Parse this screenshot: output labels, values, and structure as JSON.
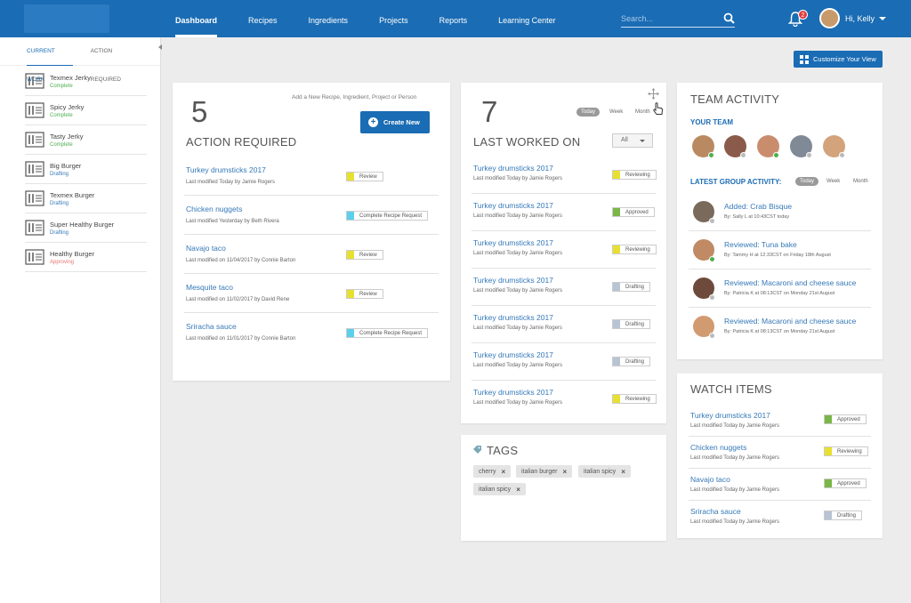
{
  "nav": {
    "items": [
      "Dashboard",
      "Recipes",
      "Ingredients",
      "Projects",
      "Reports",
      "Learning Center"
    ],
    "search_placeholder": "Search...",
    "notifications_count": "2",
    "user_greeting": "Hi, Kelly"
  },
  "sidebar": {
    "tabs": [
      "CURRENT WORK",
      "ACTION REQUIRED"
    ],
    "items": [
      {
        "name": "Texmex Jerky",
        "status": "Complete"
      },
      {
        "name": "Spicy Jerky",
        "status": "Complete"
      },
      {
        "name": "Tasty Jerky",
        "status": "Complete"
      },
      {
        "name": "Big Burger",
        "status": "Drafting"
      },
      {
        "name": "Texmex Burger",
        "status": "Drafting"
      },
      {
        "name": "Super Healthy Burger",
        "status": "Drafting"
      },
      {
        "name": "Healthy Burger",
        "status": "Approving"
      }
    ]
  },
  "customize_label": "Customize Your View",
  "action": {
    "count": "5",
    "title": "ACTION REQUIRED",
    "hint": "Add a New Recipe, Ingredient, Project or Person",
    "create_label": "Create New",
    "rows": [
      {
        "title": "Turkey drumsticks 2017",
        "sub": "Last modified Today by Jamie Rogers",
        "tag": "Review"
      },
      {
        "title": "Chicken nuggets",
        "sub": "Last modified Yesterday by Beth Rivera",
        "tag": "Complete Recipe Request"
      },
      {
        "title": "Navajo taco",
        "sub": "Last modified on 11/04/2017 by Connie Barton",
        "tag": "Review"
      },
      {
        "title": "Mesquite taco",
        "sub": "Last modified on 11/02/2017 by David Rene",
        "tag": "Review"
      },
      {
        "title": "Sriracha sauce",
        "sub": "Last modified on 11/01/2017 by Connie Barton",
        "tag": "Complete Recipe Request"
      }
    ]
  },
  "worked": {
    "count": "7",
    "title": "LAST WORKED ON",
    "periods": [
      "Today",
      "Week",
      "Month"
    ],
    "filter": "All",
    "rows": [
      {
        "title": "Turkey drumsticks 2017",
        "sub": "Last modified Today by Jamie Rogers",
        "tag": "Reviewing"
      },
      {
        "title": "Turkey drumsticks 2017",
        "sub": "Last modified Today by Jamie Rogers",
        "tag": "Approved"
      },
      {
        "title": "Turkey drumsticks 2017",
        "sub": "Last modified Today by Jamie Rogers",
        "tag": "Reviewing"
      },
      {
        "title": "Turkey drumsticks 2017",
        "sub": "Last modified Today by Jamie Rogers",
        "tag": "Drafting"
      },
      {
        "title": "Turkey drumsticks 2017",
        "sub": "Last modified Today by Jamie Rogers",
        "tag": "Drafting"
      },
      {
        "title": "Turkey drumsticks 2017",
        "sub": "Last modified Today by Jamie Rogers",
        "tag": "Drafting"
      },
      {
        "title": "Turkey drumsticks 2017",
        "sub": "Last modified Today by Jamie Rogers",
        "tag": "Reviewing"
      }
    ]
  },
  "tags": {
    "title": "TAGS",
    "items": [
      "cherry",
      "italian burger",
      "italian spicy",
      "italian spicy"
    ]
  },
  "team": {
    "title": "TEAM ACTIVITY",
    "your_team": "YOUR TEAM",
    "group_label": "LATEST GROUP ACTIVITY:",
    "periods": [
      "Today",
      "Week",
      "Month"
    ],
    "activities": [
      {
        "title": "Added:  Crab Bisque",
        "sub": "By: Sally L at 10:43CST today"
      },
      {
        "title": "Reviewed:  Tuna bake",
        "sub": "By: Tammy H at 12:33CST on Friday 18th August"
      },
      {
        "title": "Reviewed:  Macaroni and cheese sauce",
        "sub": "By: Patricia K  at 08:13CST on Monday 21st August"
      },
      {
        "title": "Reviewed:  Macaroni and cheese sauce",
        "sub": "By: Patricia K  at 08:13CST on Monday 21st August"
      }
    ]
  },
  "watch": {
    "title": "WATCH ITEMS",
    "rows": [
      {
        "title": "Turkey drumsticks 2017",
        "sub": "Last modified Today by Jamie Rogers",
        "tag": "Approved"
      },
      {
        "title": "Chicken nuggets",
        "sub": "Last modified Today by Jamie Rogers",
        "tag": "Reviewing"
      },
      {
        "title": "Navajo taco",
        "sub": "Last modified Today by Jamie Rogers",
        "tag": "Approved"
      },
      {
        "title": "Sriracha sauce",
        "sub": "Last modified Today by Jamie Rogers",
        "tag": "Drafting"
      }
    ]
  },
  "colors": {
    "brand": "#1a6cb4",
    "review": "#e8e02e",
    "request": "#5ad0ec",
    "approved": "#7ab648",
    "drafting": "#b8c3d3",
    "complete": "#4caf50",
    "drafting_text": "#3579b8",
    "approving": "#e57373"
  }
}
